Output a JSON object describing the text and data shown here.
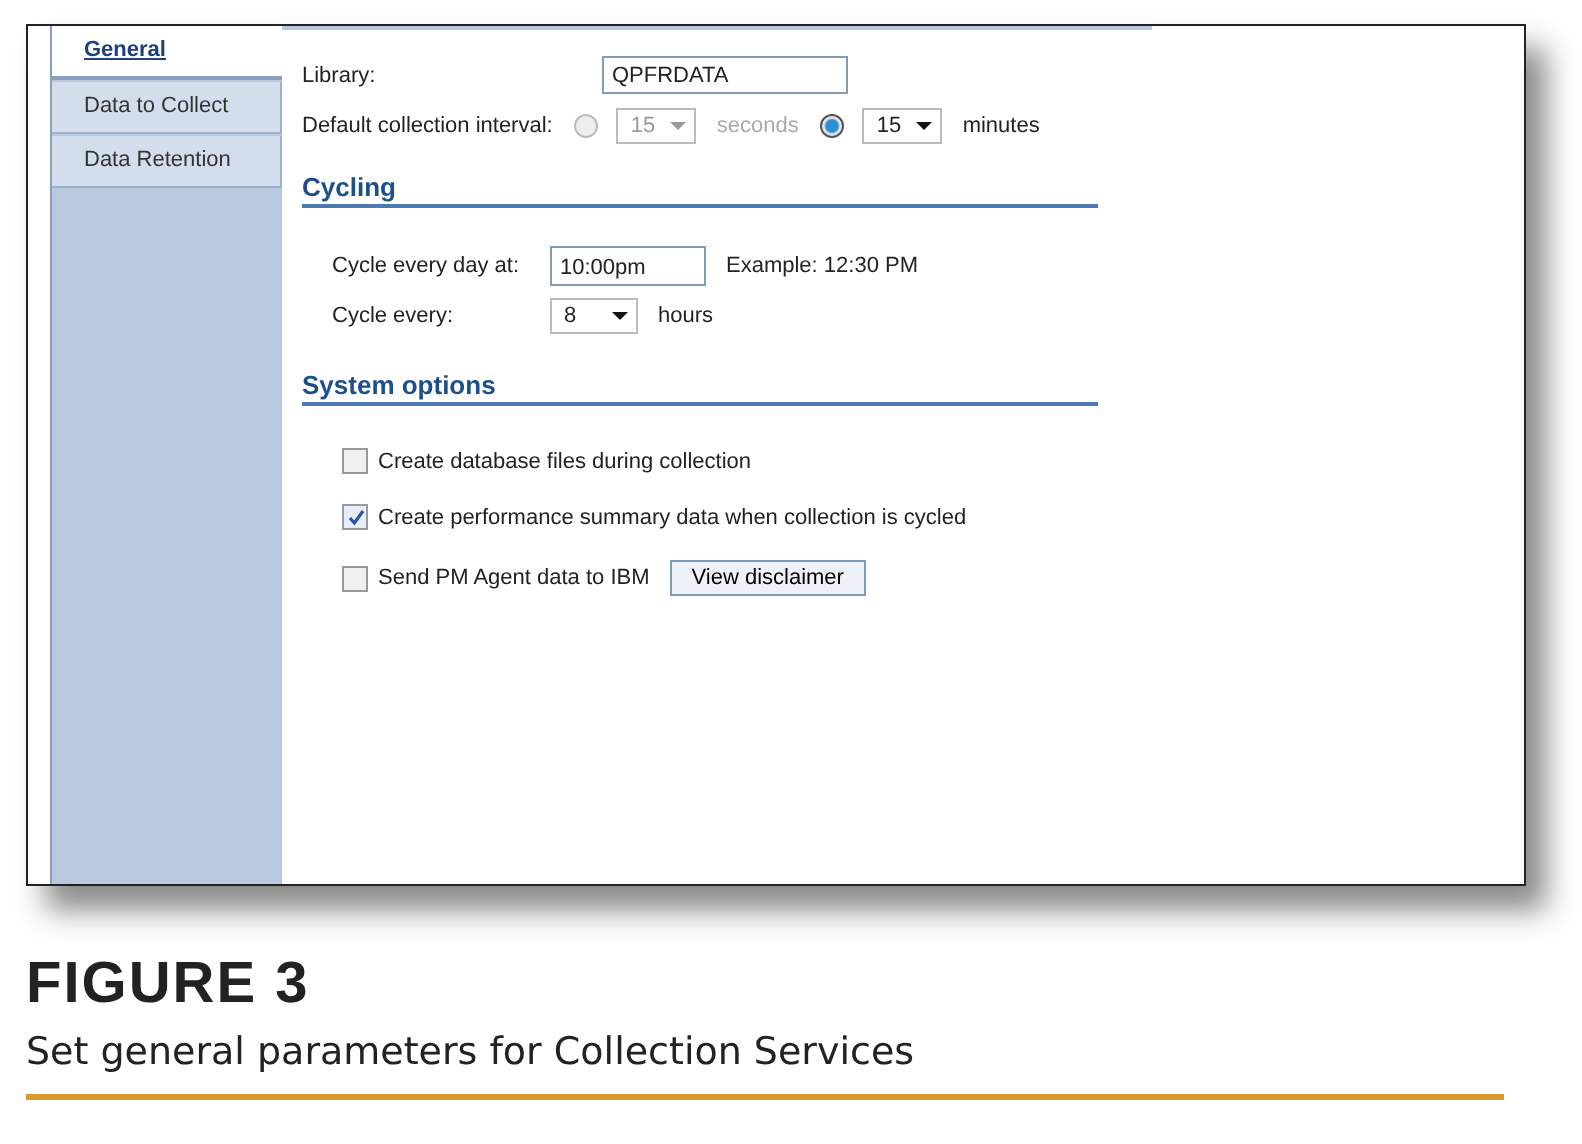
{
  "tabs": [
    {
      "label": "General",
      "selected": true
    },
    {
      "label": "Data to Collect",
      "selected": false
    },
    {
      "label": "Data Retention",
      "selected": false
    }
  ],
  "library": {
    "label": "Library:",
    "value": "QPFRDATA"
  },
  "interval": {
    "label": "Default collection interval:",
    "options": [
      {
        "value": "15",
        "unit": "seconds",
        "selected": false,
        "disabled": true
      },
      {
        "value": "15",
        "unit": "minutes",
        "selected": true,
        "disabled": false
      }
    ]
  },
  "cycling": {
    "heading": "Cycling",
    "time_label": "Cycle every day at:",
    "time_value": "10:00pm",
    "example": "Example: 12:30 PM",
    "every_label": "Cycle every:",
    "every_value": "8",
    "every_unit": "hours"
  },
  "system_options": {
    "heading": "System options",
    "options": [
      {
        "label": "Create database files during collection",
        "checked": false
      },
      {
        "label": "Create performance summary data when collection is cycled",
        "checked": true
      },
      {
        "label": "Send PM Agent data to IBM",
        "checked": false,
        "button": "View disclaimer"
      }
    ]
  },
  "caption": {
    "figure": "FIGURE 3",
    "text": "Set general parameters for Collection Services"
  }
}
